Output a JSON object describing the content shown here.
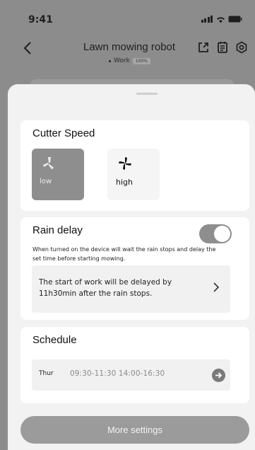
{
  "status_bar": {
    "time": "9:41"
  },
  "nav": {
    "title": "Lawn mowing robot",
    "status": "Work",
    "battery": "100%"
  },
  "cutter_speed": {
    "title": "Cutter Speed",
    "options": [
      {
        "label": "low",
        "selected": true,
        "icon": "fan-low-icon"
      },
      {
        "label": "high",
        "selected": false,
        "icon": "fan-high-icon"
      }
    ]
  },
  "rain_delay": {
    "title": "Rain delay",
    "enabled": true,
    "description": "When turned on the device will wait the rain stops and delay the set time before starting mowing.",
    "delay_text": "The start of work will be delayed by 11h30min after the rain stops."
  },
  "schedule": {
    "title": "Schedule",
    "row": {
      "day": "Thur",
      "times": "09:30-11:30  14:00-16:30"
    }
  },
  "more_settings": {
    "label": "More settings"
  },
  "colors": {
    "overlay": "#8c8c8c",
    "sheet": "#f2f2f2",
    "card": "#ffffff",
    "selected": "#8e8e8e",
    "button": "#9b9b9b"
  }
}
